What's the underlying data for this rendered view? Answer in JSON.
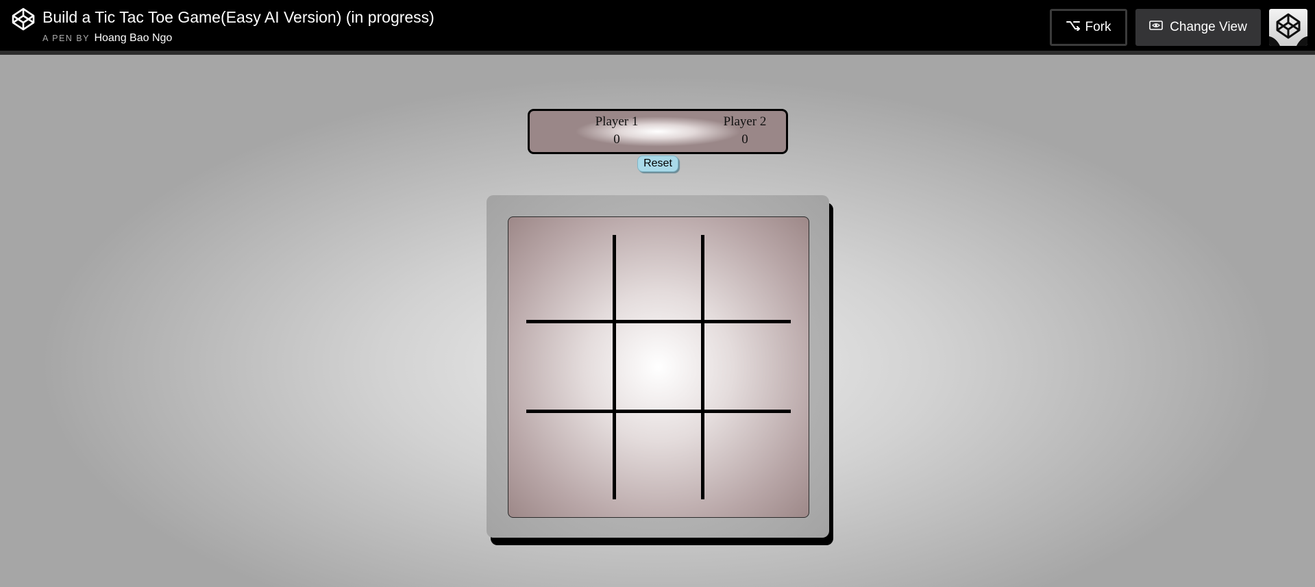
{
  "header": {
    "title": "Build a Tic Tac Toe Game(Easy AI Version) (in progress)",
    "byline_prefix": "A PEN BY",
    "author": "Hoang Bao Ngo",
    "fork_label": "Fork",
    "change_view_label": "Change View",
    "logo_icon": "codepen-logo-icon",
    "avatar_icon": "avatar"
  },
  "game": {
    "players": [
      {
        "name": "Player 1",
        "score": "0"
      },
      {
        "name": "Player 2",
        "score": "0"
      }
    ],
    "reset_label": "Reset",
    "cells": [
      "",
      "",
      "",
      "",
      "",
      "",
      "",
      "",
      ""
    ]
  },
  "colors": {
    "header_bg": "#000000",
    "reset_bg": "#a9d9e8",
    "change_view_bg": "#343436"
  }
}
